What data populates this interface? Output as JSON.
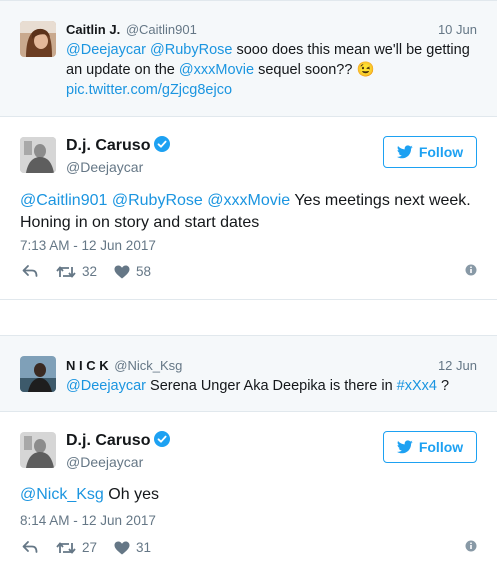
{
  "reply1": {
    "name": "Caitlin J.",
    "handle": "@Caitlin901",
    "date": "10 Jun",
    "mention1": "@Deejaycar",
    "mention2": "@RubyRose",
    "text_a": " sooo does this mean we'll be getting an update on the ",
    "mention3": "@xxxMovie",
    "text_b": " sequel soon?? ",
    "emoji": "😉",
    "link": "pic.twitter.com/gZjcg8ejco"
  },
  "tweet1": {
    "name": "D.j. Caruso",
    "handle": "@Deejaycar",
    "follow_label": "Follow",
    "mention1": "@Caitlin901",
    "mention2": "@RubyRose",
    "mention3": "@xxxMovie",
    "text": " Yes meetings next week. Honing in on story and start dates",
    "timestamp": "7:13 AM - 12 Jun 2017",
    "retweets": "32",
    "likes": "58"
  },
  "reply2": {
    "name": "N I C K",
    "handle": "@Nick_Ksg",
    "date": "12 Jun",
    "mention1": "@Deejaycar",
    "text_a": " Serena Unger Aka Deepika is there in ",
    "hashtag": "#xXx4",
    "text_b": " ?"
  },
  "tweet2": {
    "name": "D.j. Caruso",
    "handle": "@Deejaycar",
    "follow_label": "Follow",
    "mention1": "@Nick_Ksg",
    "text": " Oh yes",
    "timestamp": "8:14 AM - 12 Jun 2017",
    "retweets": "27",
    "likes": "31"
  },
  "colors": {
    "link": "#1b95e0",
    "brand": "#1da1f2",
    "muted": "#657786",
    "reply_bg": "#f5f8fa"
  },
  "icons": [
    "verified-badge-icon",
    "twitter-bird-icon",
    "reply-icon",
    "retweet-icon",
    "heart-icon",
    "info-icon"
  ]
}
